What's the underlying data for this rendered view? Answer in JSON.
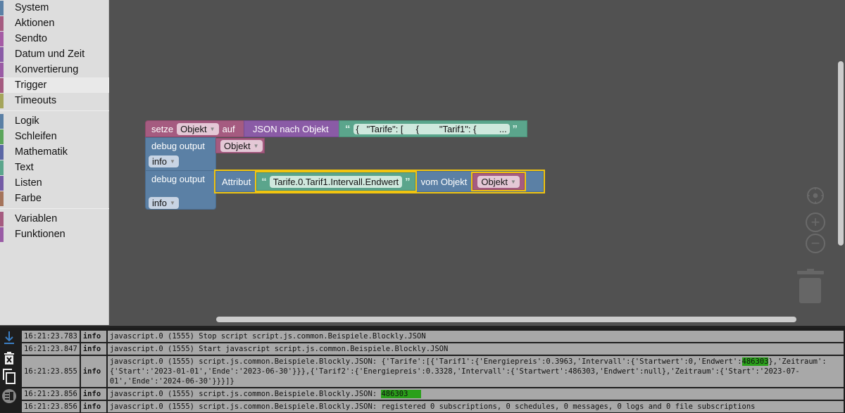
{
  "toolbox": {
    "groups": [
      [
        {
          "label": "System",
          "color": "#5b80a5"
        },
        {
          "label": "Aktionen",
          "color": "#a55b80"
        },
        {
          "label": "Sendto",
          "color": "#a55ba5"
        },
        {
          "label": "Datum und Zeit",
          "color": "#8a5ba6"
        },
        {
          "label": "Konvertierung",
          "color": "#9a5ba5"
        },
        {
          "label": "Trigger",
          "color": "#a55b80",
          "selected": true
        },
        {
          "label": "Timeouts",
          "color": "#a5a55b"
        }
      ],
      [
        {
          "label": "Logik",
          "color": "#5b80a5"
        },
        {
          "label": "Schleifen",
          "color": "#5ba55b"
        },
        {
          "label": "Mathematik",
          "color": "#5b67a5"
        },
        {
          "label": "Text",
          "color": "#5ba58c"
        },
        {
          "label": "Listen",
          "color": "#745ba5"
        },
        {
          "label": "Farbe",
          "color": "#a5745b"
        }
      ],
      [
        {
          "label": "Variablen",
          "color": "#a55b80"
        },
        {
          "label": "Funktionen",
          "color": "#995ba5"
        }
      ]
    ]
  },
  "blocks": {
    "setze": {
      "label": "setze",
      "variable": "Objekt",
      "auf": "auf"
    },
    "json_to_object": {
      "label": "JSON nach Objekt"
    },
    "json_text": {
      "open_quote": "“",
      "value": "{   \"Tarife\": [     {        \"Tarif1\": {         ...",
      "close_quote": "”"
    },
    "debug1": {
      "label": "debug output",
      "variable": "Objekt",
      "level": "info"
    },
    "debug2": {
      "label": "debug output",
      "level": "info"
    },
    "attribut": {
      "label": "Attribut",
      "path": "Tarife.0.Tarif1.Intervall.Endwert",
      "vom_objekt": "vom Objekt",
      "variable": "Objekt"
    }
  },
  "log": {
    "rows": [
      {
        "time": "16:21:23.783",
        "severity": "info",
        "message": "javascript.0 (1555) Stop script script.js.common.Beispiele.Blockly.JSON"
      },
      {
        "time": "16:21:23.847",
        "severity": "info",
        "message": "javascript.0 (1555) Start javascript script.js.common.Beispiele.Blockly.JSON"
      },
      {
        "time": "16:21:23.855",
        "severity": "info",
        "message_pre": "javascript.0 (1555) script.js.common.Beispiele.Blockly.JSON: {'Tarife':[{'Tarif1':{'Energiepreis':0.3963,'Intervall':{'Startwert':0,'Endwert':",
        "message_hl": "486303",
        "message_post": "},'Zeitraum':{'Start':'2023-01-01','Ende':'2023-06-30'}}},{'Tarif2':{'Energiepreis':0.3328,'Intervall':{'Startwert':486303,'Endwert':null},'Zeitraum':{'Start':'2023-07-01','Ende':'2024-06-30'}}}]}"
      },
      {
        "time": "16:21:23.856",
        "severity": "info",
        "message_pre": "javascript.0 (1555) script.js.common.Beispiele.Blockly.JSON: ",
        "message_hl": "486303   "
      },
      {
        "time": "16:21:23.856",
        "severity": "info",
        "message": "javascript.0 (1555) script.js.common.Beispiele.Blockly.JSON: registered 0 subscriptions, 0 schedules, 0 messages, 0 logs and 0 file subscriptions"
      }
    ]
  },
  "log_tools": [
    "scroll-down-icon",
    "clear-log-icon",
    "copy-icon",
    "toggle-panel-icon"
  ]
}
